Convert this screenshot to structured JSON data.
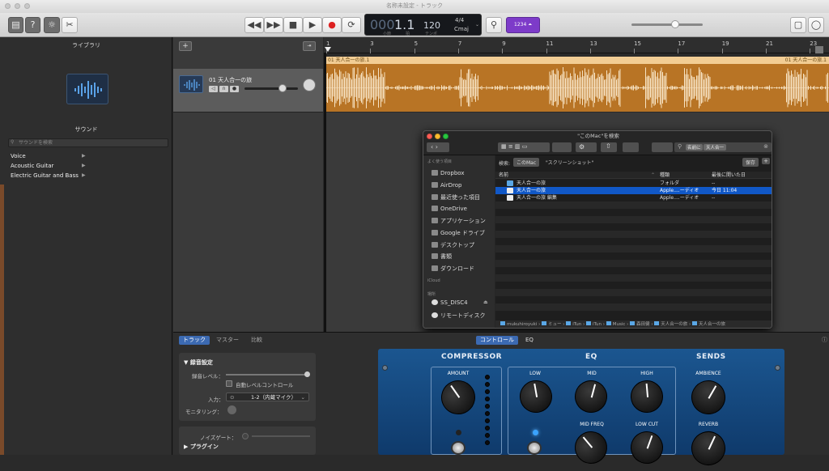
{
  "window": {
    "title": "名称未設定 - トラック"
  },
  "toolbar": {
    "lcd_bar": "1.1",
    "lcd_bpm": "120",
    "lcd_sig": "4/4",
    "lcd_key": "Cmaj",
    "lcd_bar_sub": "小節",
    "lcd_beat_sub": "拍",
    "lcd_tempo_sub": "テンポ",
    "count_in": "1234"
  },
  "library": {
    "title": "ライブラリ",
    "section": "サウンド",
    "search_placeholder": "サウンドを検索",
    "items": [
      "Voice",
      "Acoustic Guitar",
      "Electric Guitar and Bass"
    ]
  },
  "track": {
    "name": "01 天人合一の旅"
  },
  "ruler": {
    "marks": [
      "1",
      "3",
      "5",
      "7",
      "9",
      "11",
      "13",
      "15",
      "17",
      "19",
      "21",
      "23"
    ]
  },
  "region": {
    "left_label": "01 天人合一の旅.1",
    "right_label": "01 天人合一の旅.1"
  },
  "finder": {
    "title": "\"このMac\"を検索",
    "search_token": "名前に",
    "search_value": "天人合一",
    "scope_label": "検索:",
    "scope_this_mac": "このMac",
    "scope_folder": "\"スクリーンショット\"",
    "save_label": "保存",
    "sidebar_favorites_label": "よく使う項目",
    "sidebar_items": [
      "Dropbox",
      "AirDrop",
      "最近使った項目",
      "OneDrive",
      "アプリケーション",
      "Google ドライブ",
      "デスクトップ",
      "書類",
      "ダウンロード"
    ],
    "sidebar_icloud": "iCloud",
    "sidebar_places_label": "場所",
    "sidebar_places": [
      "SS_DISC4",
      "リモートディスク"
    ],
    "columns": {
      "name": "名前",
      "kind": "種類",
      "date": "最後に開いた日"
    },
    "rows": [
      {
        "name": "天人合一の旅",
        "kind": "フォルダ",
        "date": "--"
      },
      {
        "name": "天人合一の旅",
        "kind": "Apple....ーディオ",
        "date": "今日 11:04"
      },
      {
        "name": "天人合一の旅 編集",
        "kind": "Apple....ーディオ",
        "date": "--"
      }
    ],
    "path": [
      "mukuhiroyuki",
      "ミュー",
      "iTun",
      "iTun",
      "Music",
      "森田健",
      "天人合一の旅",
      "天人合一の旅"
    ]
  },
  "bottom": {
    "tabs": [
      "トラック",
      "マスター",
      "比較"
    ],
    "right_tabs": [
      "コントロール",
      "EQ"
    ],
    "rec_title": "録音設定",
    "rec_level": "録音レベル：",
    "auto_level": "自動レベルコントロール",
    "input_label": "入力：",
    "input_value": "1-2（内蔵マイク）",
    "monitor_label": "モニタリング：",
    "noise_gate": "ノイズゲート：",
    "plugins": "プラグイン"
  },
  "plugin": {
    "sections": [
      "COMPRESSOR",
      "EQ",
      "SENDS"
    ],
    "knobs": [
      "AMOUNT",
      "LOW",
      "MID",
      "HIGH",
      "AMBIENCE",
      "MID FREQ",
      "LOW CUT",
      "REVERB"
    ]
  },
  "colors": {
    "region": "#b87425",
    "region_header": "#f2cd94",
    "selection": "#1158c7",
    "plugin_blue": "#1b5690"
  }
}
